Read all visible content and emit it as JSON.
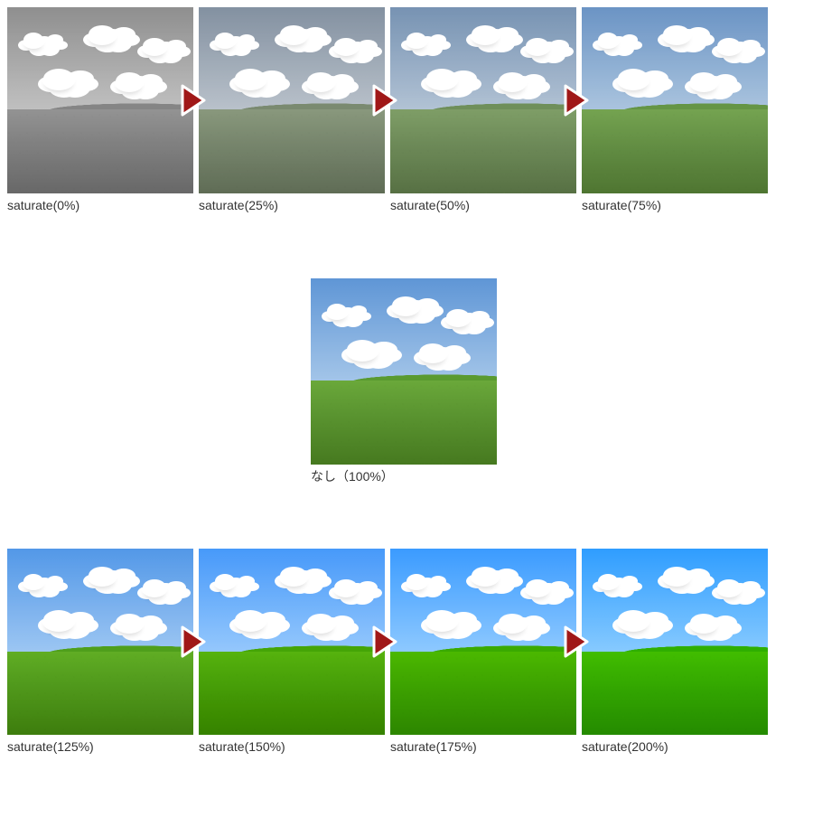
{
  "rows": [
    {
      "align": "left",
      "items": [
        {
          "label": "saturate(0%)",
          "sat_class": "sat0",
          "arrow_after": true
        },
        {
          "label": "saturate(25%)",
          "sat_class": "sat25",
          "arrow_after": true
        },
        {
          "label": "saturate(50%)",
          "sat_class": "sat50",
          "arrow_after": true
        },
        {
          "label": "saturate(75%)",
          "sat_class": "sat75",
          "arrow_after": false
        }
      ]
    },
    {
      "align": "center",
      "items": [
        {
          "label": "なし（100%）",
          "sat_class": "sat100",
          "arrow_after": false
        }
      ]
    },
    {
      "align": "left",
      "items": [
        {
          "label": "saturate(125%)",
          "sat_class": "sat125",
          "arrow_after": true
        },
        {
          "label": "saturate(150%)",
          "sat_class": "sat150",
          "arrow_after": true
        },
        {
          "label": "saturate(175%)",
          "sat_class": "sat175",
          "arrow_after": true
        },
        {
          "label": "saturate(200%)",
          "sat_class": "sat200",
          "arrow_after": false
        }
      ]
    }
  ],
  "colors": {
    "arrow_fill": "#a01818",
    "arrow_stroke": "#ffffff",
    "sky_top": "#5f96d6",
    "sky_bottom": "#a9c9ea"
  }
}
